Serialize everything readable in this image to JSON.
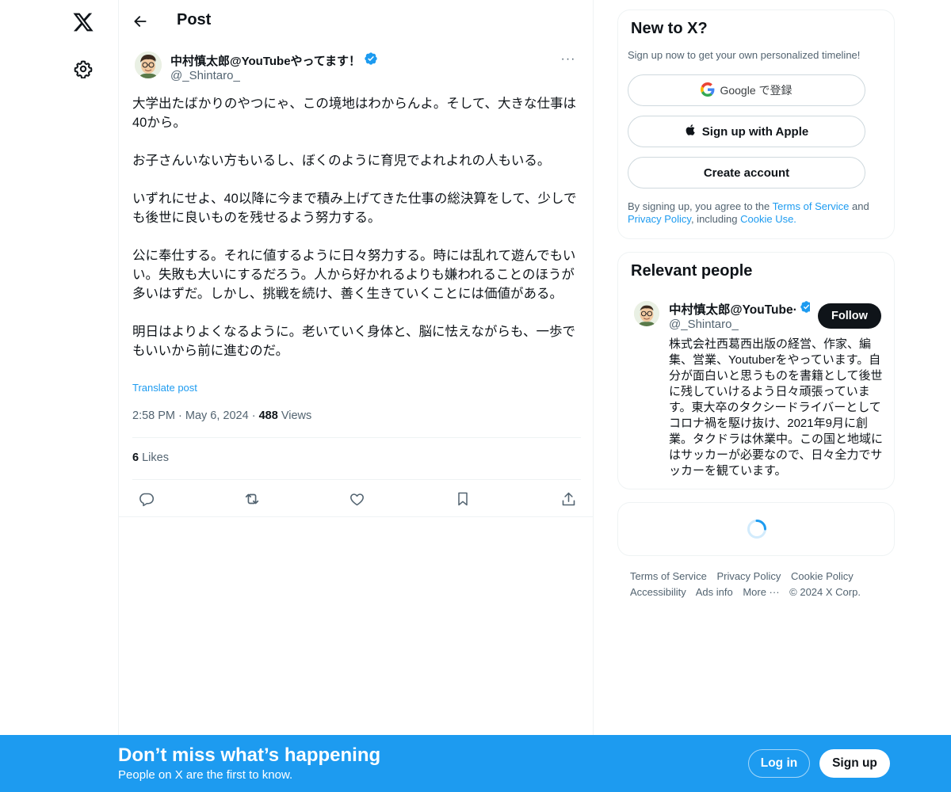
{
  "nav": {
    "logo_icon": "x-logo-icon",
    "settings_icon": "gear-icon"
  },
  "header": {
    "title": "Post",
    "back_icon": "arrow-left-icon"
  },
  "post": {
    "author_name": "中村慎太郎@YouTubeやってます！",
    "author_handle": "@_Shintaro_",
    "verified": true,
    "more_label": "···",
    "text": "大学出たばかりのやつにゃ、この境地はわからんよ。そして、大きな仕事は40から。\n\nお子さんいない方もいるし、ぼくのように育児でよれよれの人もいる。\n\nいずれにせよ、40以降に今まで積み上げてきた仕事の総決算をして、少しでも後世に良いものを残せるよう努力する。\n\n公に奉仕する。それに値するように日々努力する。時には乱れて遊んでもいい。失敗も大いにするだろう。人から好かれるよりも嫌われることのほうが多いはずだ。しかし、挑戦を続け、善く生きていくことには価値がある。\n\n明日はよりよくなるように。老いていく身体と、脳に怯えながらも、一歩でもいいから前に進むのだ。",
    "translate_label": "Translate post",
    "time": "2:58 PM",
    "date": "May 6, 2024",
    "views_count": "488",
    "views_label": "Views",
    "likes_count": "6",
    "likes_label": "Likes",
    "actions": [
      "reply-icon",
      "repost-icon",
      "like-icon",
      "bookmark-icon",
      "share-icon"
    ]
  },
  "signup_card": {
    "title": "New to X?",
    "subtitle": "Sign up now to get your own personalized timeline!",
    "google_label": "Google で登録",
    "apple_label": "Sign up with Apple",
    "create_label": "Create account",
    "legal_prefix": "By signing up, you agree to the ",
    "terms_link": "Terms of Service",
    "legal_and": " and ",
    "privacy_link": "Privacy Policy",
    "legal_including": ", including ",
    "cookie_link": "Cookie Use."
  },
  "relevant": {
    "title": "Relevant people",
    "name": "中村慎太郎@YouTube·",
    "handle": "@_Shintaro_",
    "follow_label": "Follow",
    "bio": "株式会社西葛西出版の経営、作家、編集、営業、Youtuberをやっています。自分が面白いと思うものを書籍として後世に残していけるよう日々頑張っています。東大卒のタクシードライバーとしてコロナ禍を駆け抜け、2021年9月に創業。タクドラは休業中。この国と地域にはサッカーが必要なので、日々全力でサッカーを観ています。"
  },
  "footer": {
    "links": [
      "Terms of Service",
      "Privacy Policy",
      "Cookie Policy",
      "Accessibility",
      "Ads info",
      "More ···",
      "© 2024 X Corp."
    ]
  },
  "bottom_bar": {
    "title": "Don’t miss what’s happening",
    "subtitle": "People on X are the first to know.",
    "login_label": "Log in",
    "signup_label": "Sign up"
  },
  "colors": {
    "accent": "#1d9bf0",
    "text": "#0f1419",
    "muted": "#536471",
    "border": "#eff3f4"
  }
}
